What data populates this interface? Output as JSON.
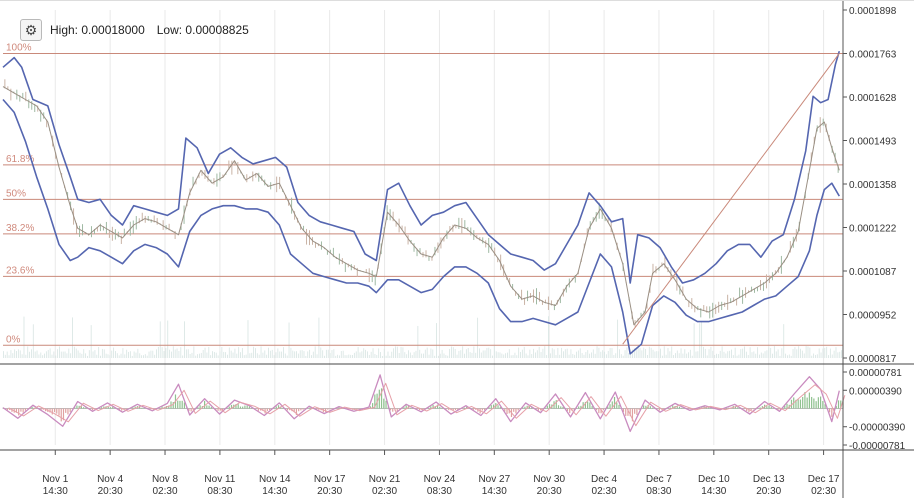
{
  "header": {
    "settings_icon": "gear-icon",
    "high_label": "High: 0.00018000",
    "low_label": "Low: 0.00008825"
  },
  "chart_data": [
    {
      "type": "line",
      "name": "price",
      "ylim": [
        8.17e-05,
        0.0001898
      ],
      "y_ticks": [
        "0.0001898",
        "0.0001763",
        "0.0001628",
        "0.0001493",
        "0.0001358",
        "0.0001222",
        "0.0001087",
        "0.0000952",
        "0.0000817"
      ],
      "x_ticks": [
        [
          "Nov 1",
          "14:30"
        ],
        [
          "Nov 4",
          "20:30"
        ],
        [
          "Nov 8",
          "02:30"
        ],
        [
          "Nov 11",
          "08:30"
        ],
        [
          "Nov 14",
          "14:30"
        ],
        [
          "Nov 17",
          "20:30"
        ],
        [
          "Nov 21",
          "02:30"
        ],
        [
          "Nov 24",
          "08:30"
        ],
        [
          "Nov 27",
          "14:30"
        ],
        [
          "Nov 30",
          "20:30"
        ],
        [
          "Dec 4",
          "02:30"
        ],
        [
          "Dec 7",
          "08:30"
        ],
        [
          "Dec 10",
          "14:30"
        ],
        [
          "Dec 13",
          "20:30"
        ],
        [
          "Dec 17",
          "02:30"
        ]
      ],
      "fib_levels": [
        {
          "label": "100%",
          "value": 0.0001763
        },
        {
          "label": "61.8%",
          "value": 0.00014168
        },
        {
          "label": "50%",
          "value": 0.00013097
        },
        {
          "label": "38.2%",
          "value": 0.00012027
        },
        {
          "label": "23.6%",
          "value": 0.00010704
        },
        {
          "label": "0%",
          "value": 8.565e-05
        }
      ],
      "price": [
        [
          0,
          0.000166
        ],
        [
          3,
          0.000164
        ],
        [
          6,
          0.000162
        ],
        [
          9,
          0.00016
        ],
        [
          12,
          0.000155
        ],
        [
          15,
          0.000141
        ],
        [
          18,
          0.000129
        ],
        [
          20,
          0.000122
        ],
        [
          23,
          0.00012
        ],
        [
          26,
          0.000123
        ],
        [
          29,
          0.000121
        ],
        [
          32,
          0.000119
        ],
        [
          35,
          0.000123
        ],
        [
          38,
          0.000125
        ],
        [
          41,
          0.000124
        ],
        [
          44,
          0.000122
        ],
        [
          47,
          0.00012
        ],
        [
          50,
          0.000133
        ],
        [
          53,
          0.00014
        ],
        [
          56,
          0.000136
        ],
        [
          59,
          0.000138
        ],
        [
          62,
          0.000143
        ],
        [
          65,
          0.000137
        ],
        [
          68,
          0.000139
        ],
        [
          71,
          0.000135
        ],
        [
          74,
          0.000136
        ],
        [
          77,
          0.000129
        ],
        [
          80,
          0.000122
        ],
        [
          83,
          0.000118
        ],
        [
          86,
          0.000116
        ],
        [
          89,
          0.000113
        ],
        [
          92,
          0.000111
        ],
        [
          95,
          0.000109
        ],
        [
          98,
          0.000108
        ],
        [
          100,
          0.000107
        ],
        [
          103,
          0.000127
        ],
        [
          106,
          0.000123
        ],
        [
          109,
          0.000118
        ],
        [
          112,
          0.000114
        ],
        [
          115,
          0.000113
        ],
        [
          118,
          0.000119
        ],
        [
          121,
          0.000123
        ],
        [
          124,
          0.000122
        ],
        [
          127,
          0.000119
        ],
        [
          130,
          0.000117
        ],
        [
          133,
          0.000112
        ],
        [
          136,
          0.000104
        ],
        [
          139,
          0.0001
        ],
        [
          142,
          0.000101
        ],
        [
          145,
          9.9e-05
        ],
        [
          148,
          9.8e-05
        ],
        [
          151,
          0.000104
        ],
        [
          154,
          0.000108
        ],
        [
          157,
          0.000122
        ],
        [
          160,
          0.000128
        ],
        [
          163,
          0.000122
        ],
        [
          166,
          0.000111
        ],
        [
          169,
          9.2e-05
        ],
        [
          172,
          9.6e-05
        ],
        [
          174,
          0.000108
        ],
        [
          177,
          0.000111
        ],
        [
          180,
          0.000106
        ],
        [
          183,
          0.0001
        ],
        [
          186,
          9.7e-05
        ],
        [
          189,
          9.6e-05
        ],
        [
          192,
          9.8e-05
        ],
        [
          195,
          9.9e-05
        ],
        [
          198,
          0.000101
        ],
        [
          201,
          0.000103
        ],
        [
          204,
          0.000105
        ],
        [
          207,
          0.000108
        ],
        [
          210,
          0.000113
        ],
        [
          213,
          0.000121
        ],
        [
          216,
          0.00014
        ],
        [
          218,
          0.000153
        ],
        [
          220,
          0.000155
        ],
        [
          222,
          0.000147
        ],
        [
          224,
          0.00014
        ]
      ],
      "bollinger_upper": [
        [
          0,
          0.000172
        ],
        [
          3,
          0.000175
        ],
        [
          5,
          0.000172
        ],
        [
          8,
          0.000162
        ],
        [
          12,
          0.00016
        ],
        [
          15,
          0.000148
        ],
        [
          18,
          0.000138
        ],
        [
          20,
          0.000131
        ],
        [
          23,
          0.00013
        ],
        [
          26,
          0.000131
        ],
        [
          29,
          0.000126
        ],
        [
          32,
          0.000123
        ],
        [
          35,
          0.000129
        ],
        [
          38,
          0.000128
        ],
        [
          41,
          0.000127
        ],
        [
          44,
          0.000126
        ],
        [
          47,
          0.000128
        ],
        [
          49,
          0.00015
        ],
        [
          52,
          0.000147
        ],
        [
          55,
          0.000139
        ],
        [
          58,
          0.000145
        ],
        [
          61,
          0.000147
        ],
        [
          64,
          0.000144
        ],
        [
          67,
          0.000142
        ],
        [
          70,
          0.000143
        ],
        [
          73,
          0.000144
        ],
        [
          76,
          0.000141
        ],
        [
          79,
          0.00013
        ],
        [
          82,
          0.000126
        ],
        [
          85,
          0.000124
        ],
        [
          88,
          0.000123
        ],
        [
          91,
          0.000122
        ],
        [
          94,
          0.000121
        ],
        [
          97,
          0.000114
        ],
        [
          100,
          0.000112
        ],
        [
          103,
          0.000134
        ],
        [
          106,
          0.000136
        ],
        [
          109,
          0.000129
        ],
        [
          112,
          0.000123
        ],
        [
          115,
          0.000126
        ],
        [
          118,
          0.000127
        ],
        [
          121,
          0.000129
        ],
        [
          124,
          0.00013
        ],
        [
          127,
          0.000125
        ],
        [
          130,
          0.00012
        ],
        [
          133,
          0.000117
        ],
        [
          136,
          0.000114
        ],
        [
          139,
          0.000113
        ],
        [
          142,
          0.000112
        ],
        [
          145,
          0.000109
        ],
        [
          148,
          0.000111
        ],
        [
          151,
          0.000117
        ],
        [
          154,
          0.000123
        ],
        [
          157,
          0.000133
        ],
        [
          160,
          0.000129
        ],
        [
          163,
          0.000124
        ],
        [
          166,
          0.000125
        ],
        [
          168,
          0.000105
        ],
        [
          170,
          0.00012
        ],
        [
          173,
          0.000119
        ],
        [
          176,
          0.000116
        ],
        [
          179,
          0.00011
        ],
        [
          182,
          0.000105
        ],
        [
          185,
          0.000106
        ],
        [
          188,
          0.000108
        ],
        [
          191,
          0.000111
        ],
        [
          194,
          0.000115
        ],
        [
          197,
          0.000117
        ],
        [
          200,
          0.000117
        ],
        [
          203,
          0.000113
        ],
        [
          206,
          0.000118
        ],
        [
          209,
          0.00012
        ],
        [
          212,
          0.000131
        ],
        [
          215,
          0.000146
        ],
        [
          217,
          0.000163
        ],
        [
          219,
          0.000161
        ],
        [
          221,
          0.000162
        ],
        [
          223,
          0.000173
        ],
        [
          224,
          0.000177
        ]
      ],
      "bollinger_lower": [
        [
          0,
          0.000162
        ],
        [
          3,
          0.000158
        ],
        [
          6,
          0.000149
        ],
        [
          9,
          0.000138
        ],
        [
          12,
          0.000128
        ],
        [
          15,
          0.000117
        ],
        [
          18,
          0.000112
        ],
        [
          20,
          0.000113
        ],
        [
          23,
          0.000116
        ],
        [
          26,
          0.000115
        ],
        [
          29,
          0.000113
        ],
        [
          32,
          0.000111
        ],
        [
          35,
          0.000115
        ],
        [
          38,
          0.000117
        ],
        [
          41,
          0.000116
        ],
        [
          44,
          0.000114
        ],
        [
          47,
          0.00011
        ],
        [
          50,
          0.000121
        ],
        [
          53,
          0.000126
        ],
        [
          56,
          0.000128
        ],
        [
          59,
          0.000129
        ],
        [
          62,
          0.000129
        ],
        [
          65,
          0.000128
        ],
        [
          68,
          0.000128
        ],
        [
          71,
          0.000127
        ],
        [
          74,
          0.000123
        ],
        [
          77,
          0.000114
        ],
        [
          80,
          0.000111
        ],
        [
          83,
          0.000108
        ],
        [
          86,
          0.000107
        ],
        [
          89,
          0.000106
        ],
        [
          92,
          0.000105
        ],
        [
          95,
          0.000105
        ],
        [
          98,
          0.000104
        ],
        [
          100,
          0.000102
        ],
        [
          103,
          0.000106
        ],
        [
          106,
          0.000106
        ],
        [
          109,
          0.000104
        ],
        [
          112,
          0.000102
        ],
        [
          115,
          0.000103
        ],
        [
          118,
          0.000107
        ],
        [
          121,
          0.00011
        ],
        [
          124,
          0.00011
        ],
        [
          127,
          0.000108
        ],
        [
          130,
          0.000105
        ],
        [
          133,
          9.7e-05
        ],
        [
          136,
          9.3e-05
        ],
        [
          139,
          9.3e-05
        ],
        [
          142,
          9.4e-05
        ],
        [
          145,
          9.3e-05
        ],
        [
          148,
          9.2e-05
        ],
        [
          151,
          9.4e-05
        ],
        [
          154,
          9.6e-05
        ],
        [
          157,
          0.000105
        ],
        [
          160,
          0.000114
        ],
        [
          163,
          0.00011
        ],
        [
          166,
          9.6e-05
        ],
        [
          168,
          8.3e-05
        ],
        [
          171,
          8.6e-05
        ],
        [
          174,
          9.8e-05
        ],
        [
          177,
          0.000101
        ],
        [
          180,
          9.9e-05
        ],
        [
          183,
          9.5e-05
        ],
        [
          186,
          9.3e-05
        ],
        [
          189,
          9.3e-05
        ],
        [
          192,
          9.4e-05
        ],
        [
          195,
          9.5e-05
        ],
        [
          198,
          9.6e-05
        ],
        [
          201,
          9.8e-05
        ],
        [
          204,
          0.0001
        ],
        [
          207,
          0.000101
        ],
        [
          210,
          0.000104
        ],
        [
          213,
          0.000107
        ],
        [
          216,
          0.000115
        ],
        [
          218,
          0.000126
        ],
        [
          220,
          0.000134
        ],
        [
          222,
          0.000136
        ],
        [
          224,
          0.000132
        ]
      ],
      "trend_line": [
        [
          166,
          8.6e-05
        ],
        [
          224,
          0.0001763
        ]
      ]
    },
    {
      "type": "line",
      "name": "oscillator",
      "ylim": [
        -7.81e-06,
        7.81e-06
      ],
      "y_ticks": [
        "0.00000781",
        "0.00000390",
        "-0.00000390",
        "-0.00000781"
      ],
      "values": [
        [
          0,
          2e-07
        ],
        [
          4,
          -2.1e-06
        ],
        [
          8,
          7e-07
        ],
        [
          12,
          -1.3e-06
        ],
        [
          16,
          -3.8e-06
        ],
        [
          20,
          1.5e-06
        ],
        [
          24,
          -6e-07
        ],
        [
          28,
          1.2e-06
        ],
        [
          32,
          -8e-07
        ],
        [
          36,
          9e-07
        ],
        [
          40,
          -5e-07
        ],
        [
          44,
          1.1e-06
        ],
        [
          47,
          5.2e-06
        ],
        [
          50,
          -1.4e-06
        ],
        [
          54,
          2.1e-06
        ],
        [
          58,
          -1.2e-06
        ],
        [
          62,
          1.8e-06
        ],
        [
          66,
          6e-07
        ],
        [
          70,
          -1.5e-06
        ],
        [
          74,
          1.2e-06
        ],
        [
          78,
          -2.2e-06
        ],
        [
          82,
          5e-07
        ],
        [
          86,
          -1.1e-06
        ],
        [
          90,
          4e-07
        ],
        [
          94,
          -6e-07
        ],
        [
          98,
          3e-07
        ],
        [
          101,
          7.2e-06
        ],
        [
          104,
          -1.8e-06
        ],
        [
          108,
          9e-07
        ],
        [
          112,
          -7e-07
        ],
        [
          116,
          1.4e-06
        ],
        [
          120,
          -1.2e-06
        ],
        [
          124,
          6e-07
        ],
        [
          128,
          -1.5e-06
        ],
        [
          132,
          2.1e-06
        ],
        [
          136,
          -2.8e-06
        ],
        [
          140,
          1.2e-06
        ],
        [
          144,
          -9e-07
        ],
        [
          148,
          3.1e-06
        ],
        [
          152,
          -1.8e-06
        ],
        [
          156,
          3.4e-06
        ],
        [
          160,
          -2.2e-06
        ],
        [
          164,
          3.5e-06
        ],
        [
          168,
          -4.9e-06
        ],
        [
          172,
          1.8e-06
        ],
        [
          176,
          -8e-07
        ],
        [
          180,
          1.1e-06
        ],
        [
          184,
          -4e-07
        ],
        [
          188,
          6e-07
        ],
        [
          192,
          -3e-07
        ],
        [
          196,
          9e-07
        ],
        [
          200,
          -1.2e-06
        ],
        [
          204,
          1.5e-06
        ],
        [
          208,
          -6e-07
        ],
        [
          212,
          3.2e-06
        ],
        [
          216,
          6.8e-06
        ],
        [
          219,
          4.1e-06
        ],
        [
          222,
          -2.8e-06
        ],
        [
          224,
          3.8e-06
        ]
      ]
    }
  ]
}
